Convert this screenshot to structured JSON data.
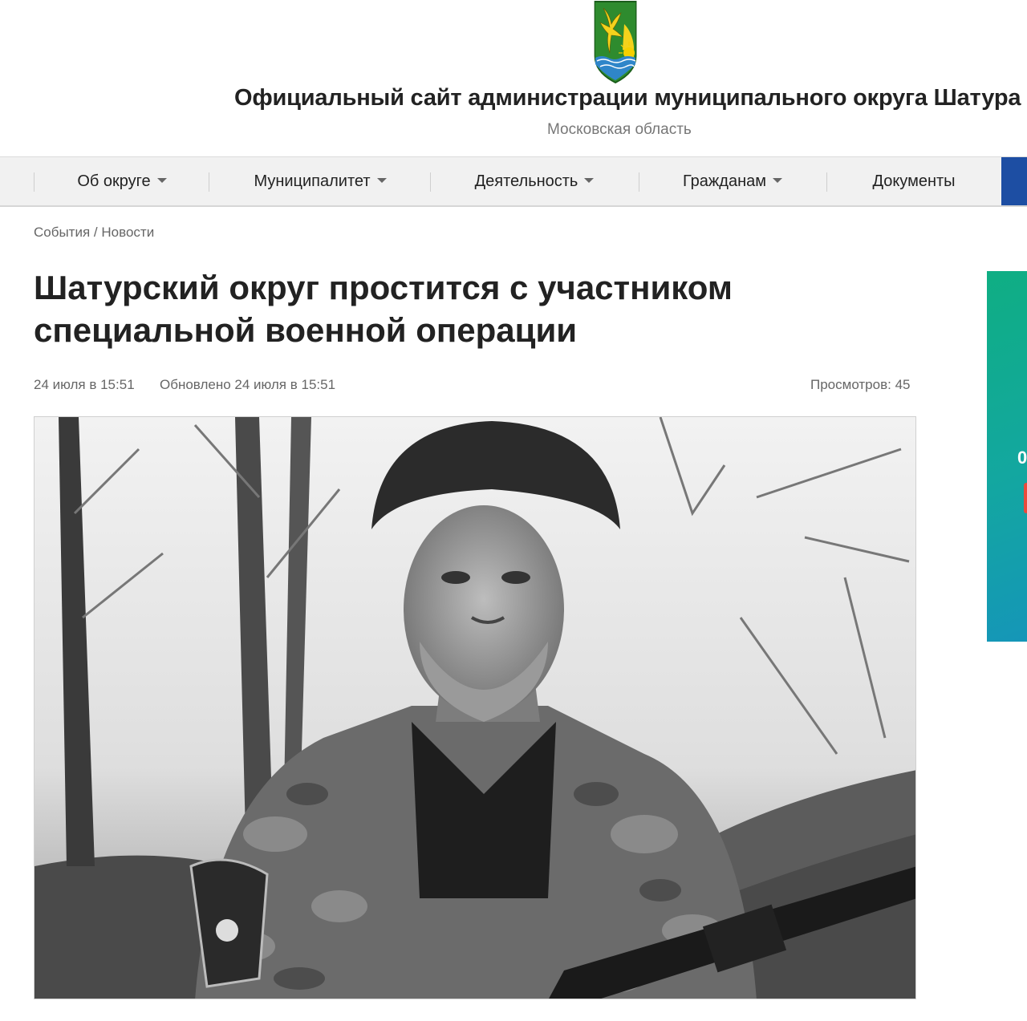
{
  "header": {
    "coat_of_arms_icon": "coat-of-arms-icon",
    "title": "Официальный сайт администрации муниципального округа Шатура",
    "subtitle": "Московская область"
  },
  "nav": {
    "items": [
      {
        "label": "Об округе",
        "has_dropdown": true
      },
      {
        "label": "Муниципалитет",
        "has_dropdown": true
      },
      {
        "label": "Деятельность",
        "has_dropdown": true
      },
      {
        "label": "Гражданам",
        "has_dropdown": true
      },
      {
        "label": "Документы",
        "has_dropdown": false
      }
    ],
    "accent_color": "#1d4ea3"
  },
  "breadcrumb": {
    "items": [
      "События",
      "Новости"
    ],
    "separator": "/"
  },
  "article": {
    "title": "Шатурский округ простится с участником специальной военной операции",
    "published": "24 июля в 15:51",
    "updated": "Обновлено 24 июля в 15:51",
    "views": "Просмотров: 45",
    "image": "black-and-white portrait photo"
  },
  "side_banner": {
    "visible_text": "0",
    "colors": [
      "#0fae83",
      "#1596b8"
    ]
  }
}
